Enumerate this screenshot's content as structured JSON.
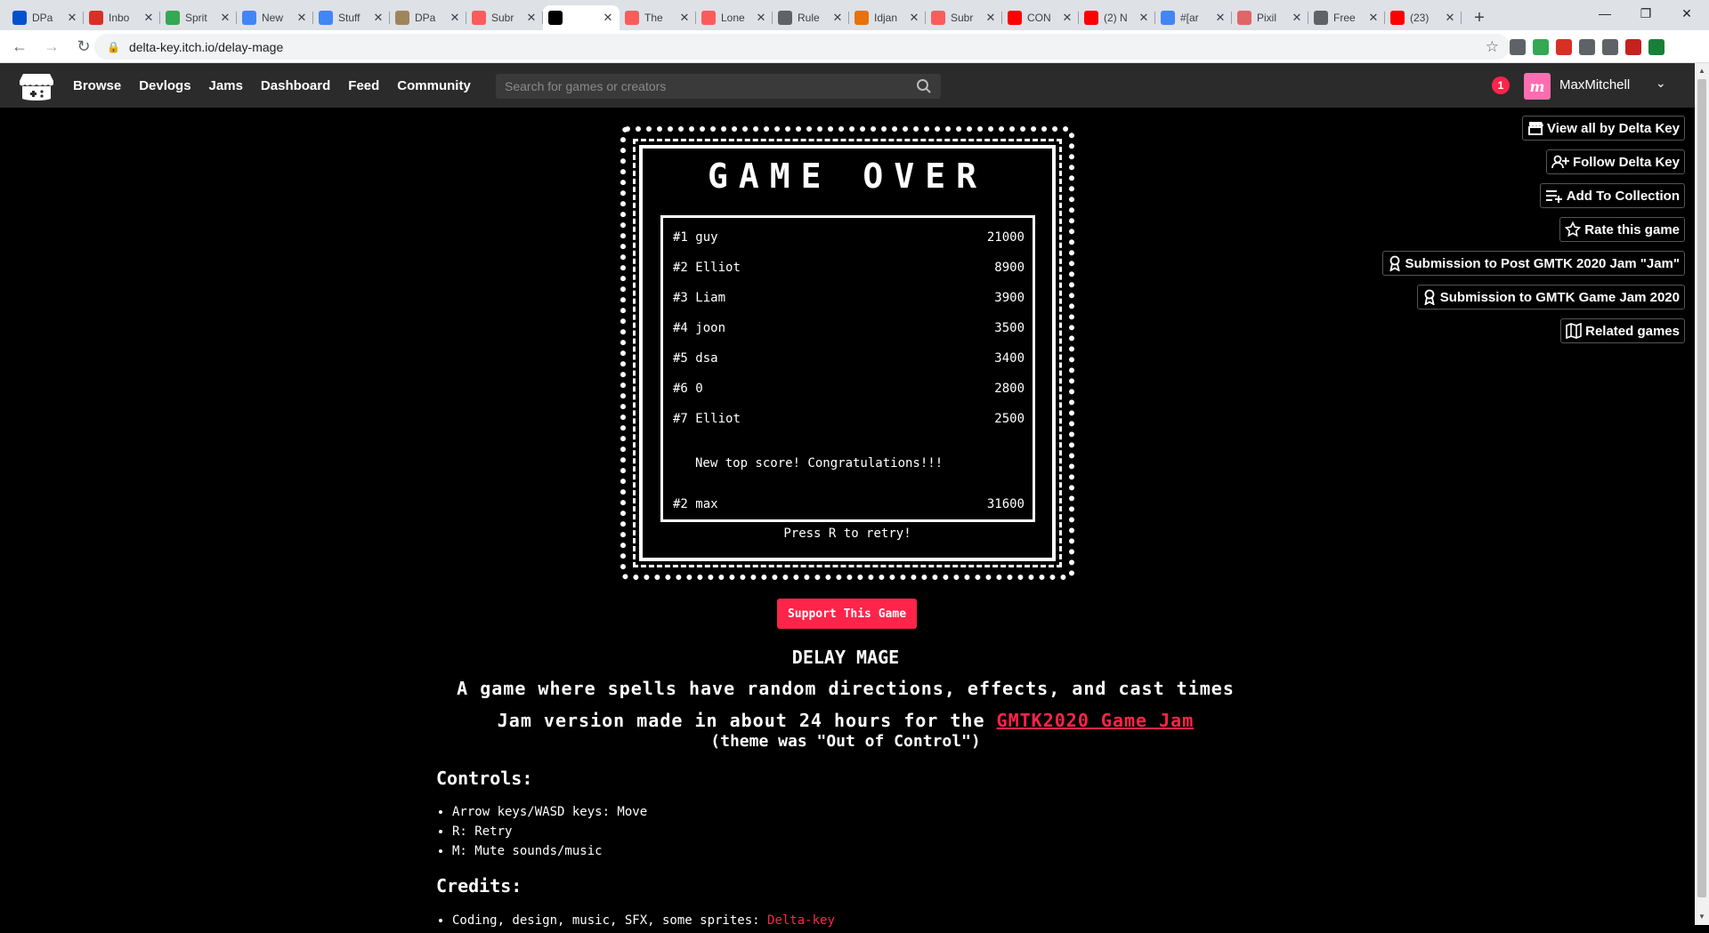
{
  "browser": {
    "tabs": [
      {
        "title": "DPa",
        "color": "#0052cc"
      },
      {
        "title": "Inbo",
        "color": "#d93025"
      },
      {
        "title": "Sprit",
        "color": "#34a853"
      },
      {
        "title": "New",
        "color": "#4285f4"
      },
      {
        "title": "Stuff",
        "color": "#4285f4"
      },
      {
        "title": "DPa",
        "color": "#a0855b"
      },
      {
        "title": "Subr",
        "color": "#fa5c5c"
      },
      {
        "title": "",
        "color": "#000000"
      },
      {
        "title": "The",
        "color": "#fa5c5c"
      },
      {
        "title": "Lone",
        "color": "#fa5c5c"
      },
      {
        "title": "Rule",
        "color": "#5f6368"
      },
      {
        "title": "Idjan",
        "color": "#e8710a"
      },
      {
        "title": "Subr",
        "color": "#fa5c5c"
      },
      {
        "title": "CON",
        "color": "#ff0000"
      },
      {
        "title": "(2) N",
        "color": "#ff0000"
      },
      {
        "title": "#[ar",
        "color": "#4285f4"
      },
      {
        "title": "Pixil",
        "color": "#e06666"
      },
      {
        "title": "Free",
        "color": "#5f6368"
      },
      {
        "title": "(23)",
        "color": "#ff0000"
      }
    ],
    "url": "delta-key.itch.io/delay-mage",
    "extension_colors": [
      "#5f6368",
      "#34a853",
      "#d93025",
      "#5f6368",
      "#5f6368",
      "#c5221f",
      "#188038"
    ]
  },
  "itch": {
    "nav": [
      "Browse",
      "Devlogs",
      "Jams",
      "Dashboard",
      "Feed",
      "Community"
    ],
    "search_placeholder": "Search for games or creators",
    "notification_count": "1",
    "avatar_letter": "m",
    "username": "MaxMitchell"
  },
  "actions": [
    {
      "label": "View all by Delta Key",
      "icon": "store-icon"
    },
    {
      "label": "Follow Delta Key",
      "icon": "follow-user-icon"
    },
    {
      "label": "Add To Collection",
      "icon": "add-collection-icon"
    },
    {
      "label": "Rate this game",
      "icon": "star-icon"
    },
    {
      "label": "Submission to Post GMTK 2020 Jam \"Jam\"",
      "icon": "award-icon"
    },
    {
      "label": "Submission to GMTK Game Jam 2020",
      "icon": "award-icon"
    },
    {
      "label": "Related games",
      "icon": "map-icon"
    }
  ],
  "game": {
    "title": "GAME OVER",
    "scores": [
      {
        "rank": "#1",
        "name": "guy",
        "score": "21000"
      },
      {
        "rank": "#2",
        "name": "Elliot",
        "score": "8900"
      },
      {
        "rank": "#3",
        "name": "Liam",
        "score": "3900"
      },
      {
        "rank": "#4",
        "name": "joon",
        "score": "3500"
      },
      {
        "rank": "#5",
        "name": "dsa",
        "score": "3400"
      },
      {
        "rank": "#6",
        "name": "0",
        "score": "2800"
      },
      {
        "rank": "#7",
        "name": "Elliot",
        "score": "2500"
      }
    ],
    "congrats": "New top score! Congratulations!!!",
    "player": {
      "rank": "#2",
      "name": "max",
      "score": "31600"
    },
    "retry": "Press R to retry!"
  },
  "page": {
    "support": "Support This Game",
    "name": "DELAY MAGE",
    "tagline": "A game where spells have random directions, effects, and cast times",
    "jam_prefix": "Jam version made in about 24 hours for the ",
    "jam_link": "GMTK2020 Game Jam",
    "theme": "(theme was \"Out of Control\")",
    "controls_heading": "Controls:",
    "controls": [
      "Arrow keys/WASD keys: Move",
      "R: Retry",
      "M: Mute sounds/music"
    ],
    "credits_heading": "Credits:",
    "credit_prefix": "Coding, design, music, SFX, some sprites: ",
    "credit_link": "Delta-key"
  }
}
